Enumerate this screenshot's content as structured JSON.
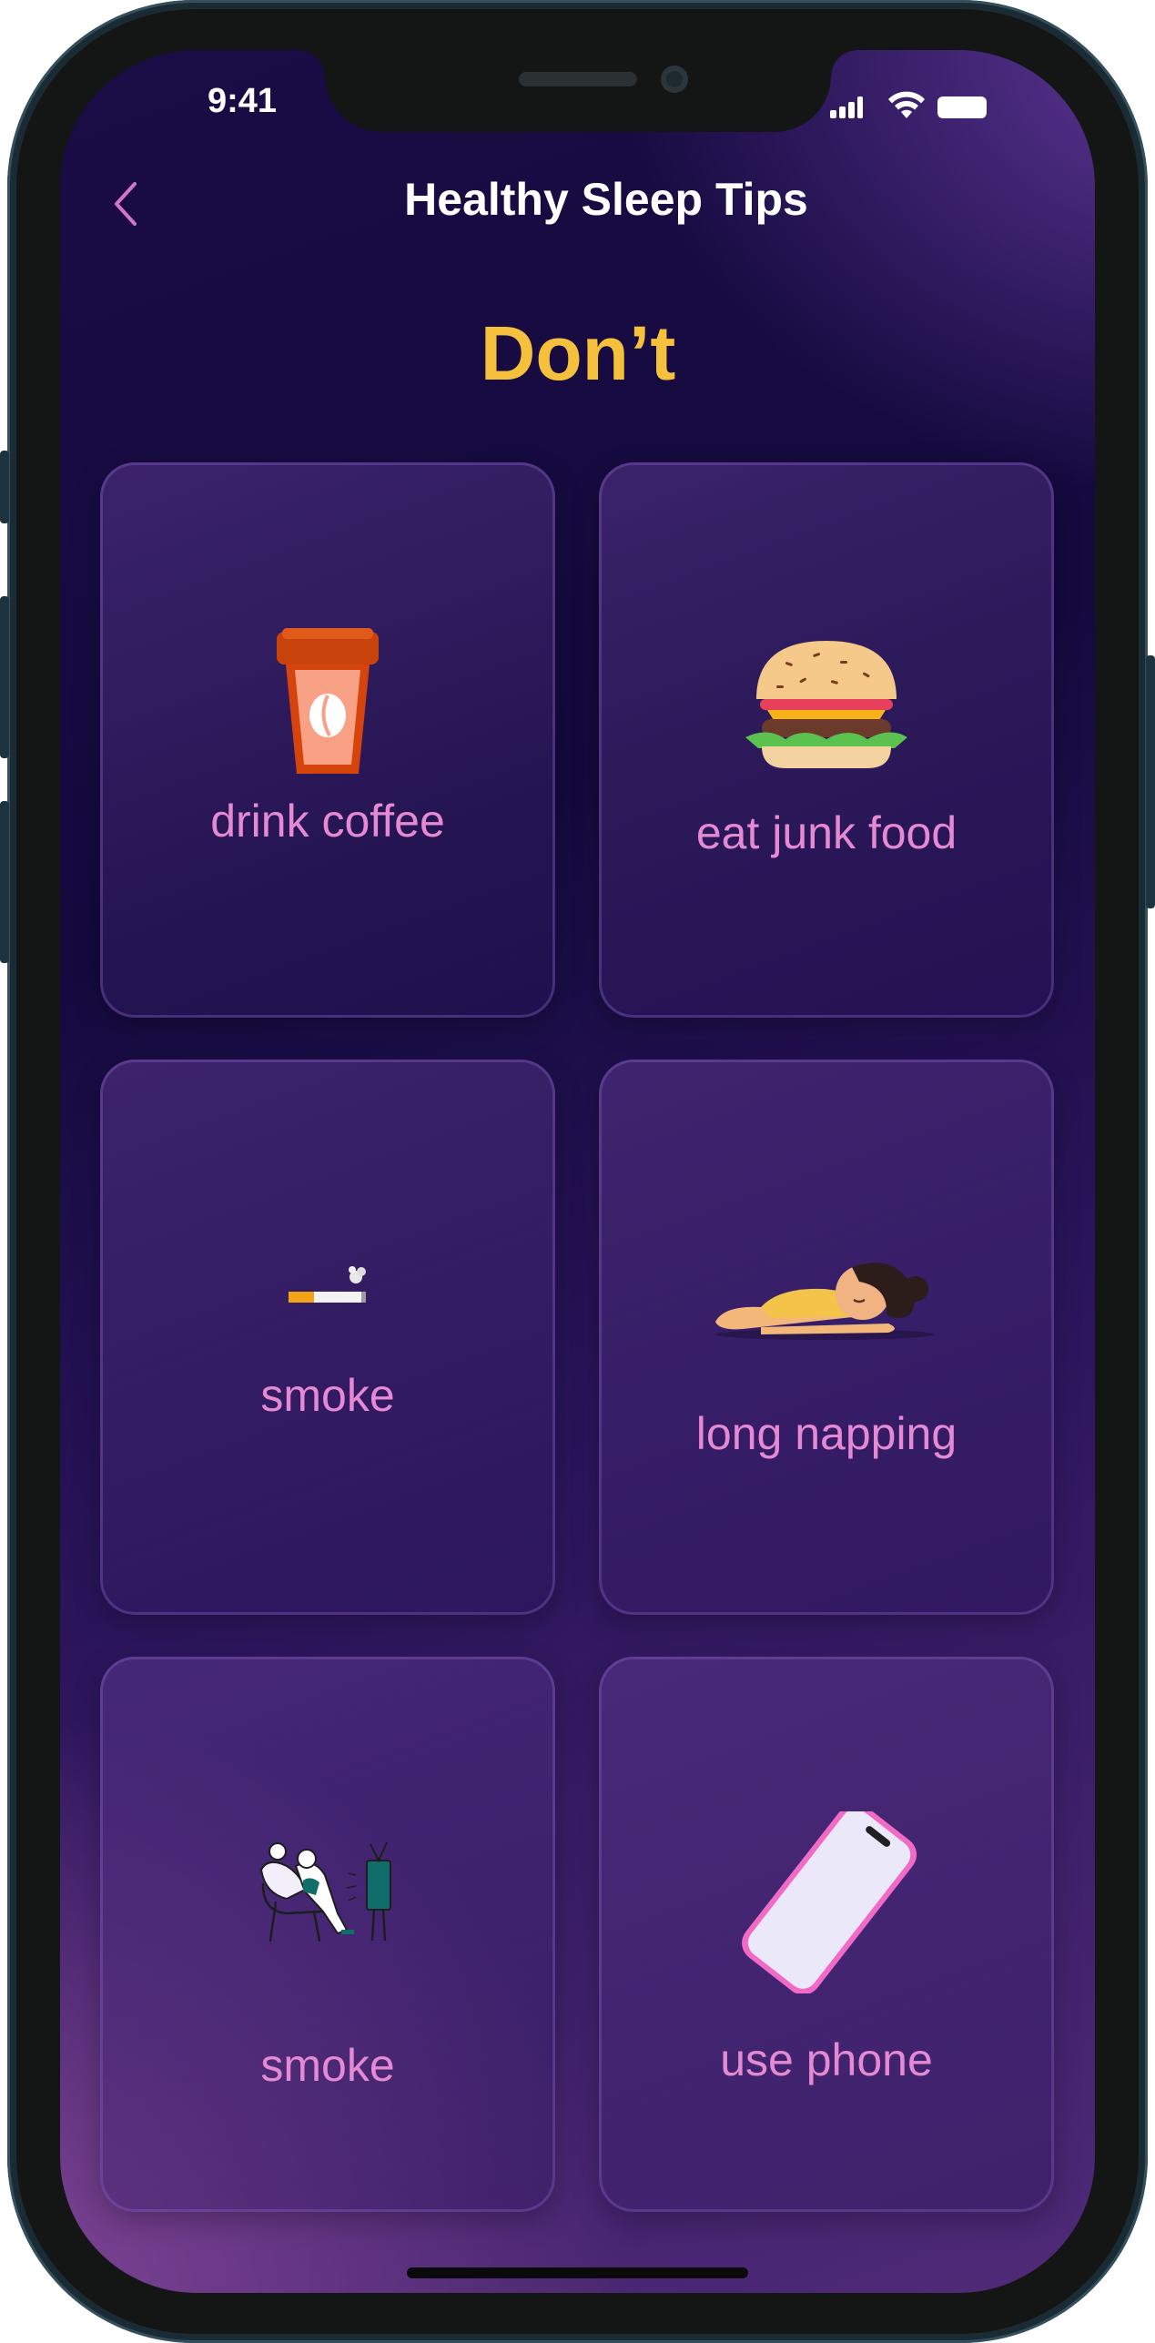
{
  "status_bar": {
    "time": "9:41"
  },
  "header": {
    "title": "Healthy Sleep Tips"
  },
  "section": {
    "heading": "Don’t"
  },
  "tips": [
    {
      "label": "drink coffee",
      "icon": "coffee-cup-icon"
    },
    {
      "label": "eat junk food",
      "icon": "burger-icon"
    },
    {
      "label": "smoke",
      "icon": "cigarette-icon"
    },
    {
      "label": "long napping",
      "icon": "sleeping-person-icon"
    },
    {
      "label": "smoke",
      "icon": "watching-tv-icon"
    },
    {
      "label": "use phone",
      "icon": "phone-icon"
    }
  ],
  "colors": {
    "accent_heading": "#f5c13c",
    "label": "#e58ad2",
    "background": "#1a0c45"
  }
}
